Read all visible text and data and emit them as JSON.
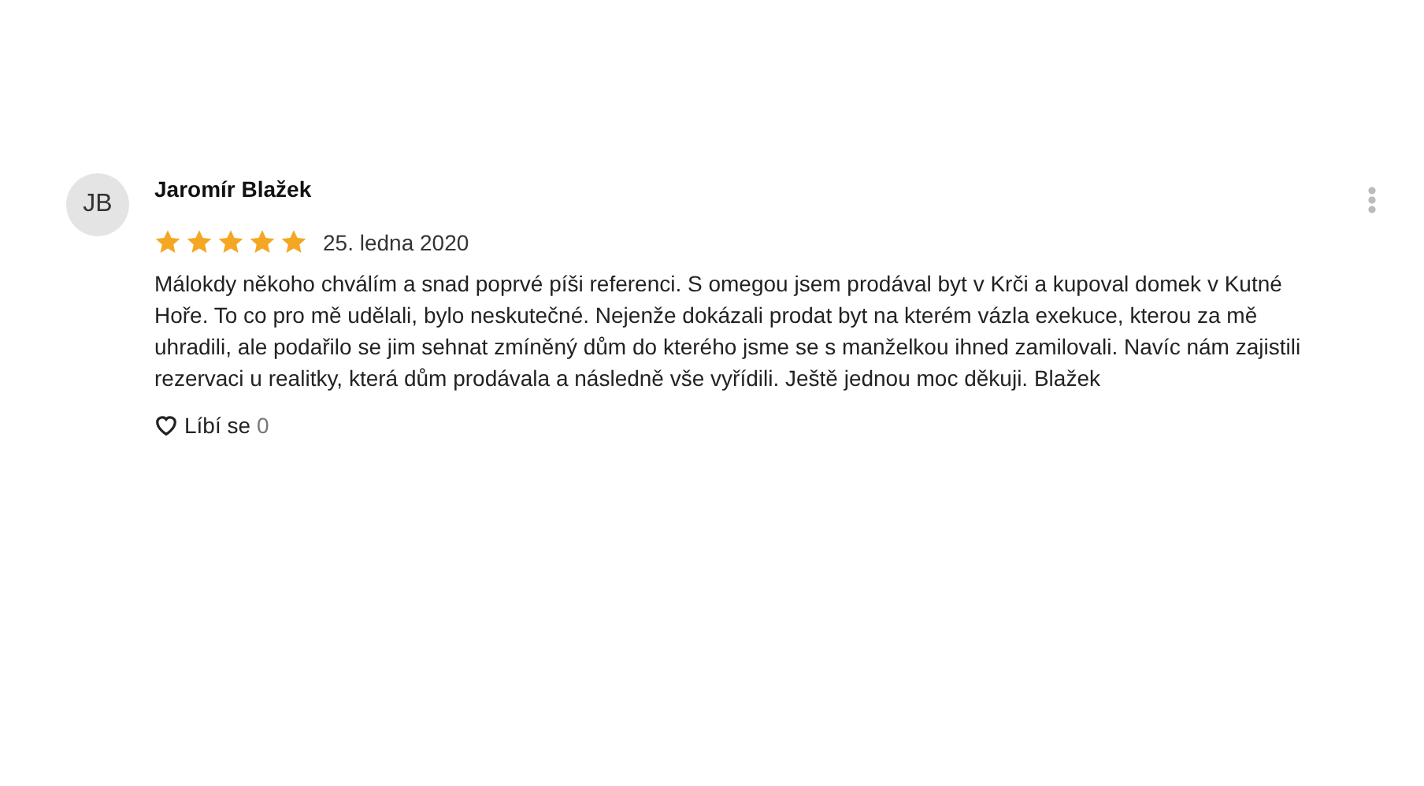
{
  "review": {
    "avatar": "JB",
    "author": "Jaromír Blažek",
    "stars": 5,
    "date": "25. ledna 2020",
    "text": "Málokdy někoho chválím a snad poprvé píši referenci. S omegou jsem prodával byt v Krči a kupoval domek v Kutné Hoře. To co pro mě udělali, bylo neskutečné. Nejenže dokázali prodat byt na kterém vázla exekuce, kterou za mě uhradili, ale podařilo se jim sehnat zmíněný dům do kterého jsme se s manželkou ihned zamilovali. Navíc nám zajistili rezervaci u realitky, která dům prodávala a následně vše vyřídili. Ještě jednou moc děkuji. Blažek",
    "like_label": "Líbí se",
    "like_count": "0"
  }
}
